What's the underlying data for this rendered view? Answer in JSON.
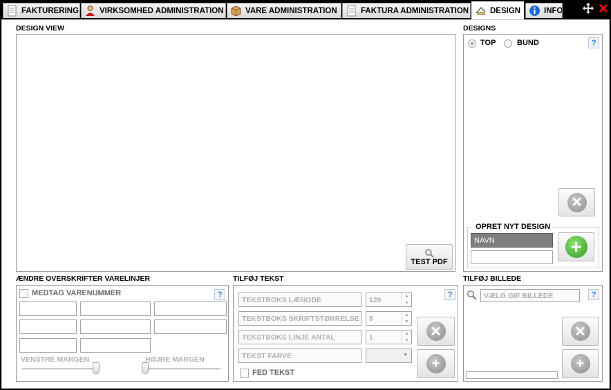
{
  "tabs": [
    {
      "label": "FAKTURERING",
      "icon": "document-icon"
    },
    {
      "label": "VIRKSOMHED ADMINISTRATION",
      "icon": "user-icon"
    },
    {
      "label": "VARE ADMINISTRATION",
      "icon": "box-icon"
    },
    {
      "label": "FAKTURA ADMINISTRATION",
      "icon": "document-icon"
    },
    {
      "label": "DESIGN",
      "icon": "design-icon",
      "active": true
    },
    {
      "label": "INFO",
      "icon": "info-icon"
    }
  ],
  "design_view": {
    "title": "DESIGN VIEW",
    "test_pdf_label": "TEST PDF"
  },
  "designs": {
    "title": "DESIGNS",
    "radio_top": "TOP",
    "radio_bund": "BUND",
    "help": "?",
    "new_design": {
      "title": "OPRET NYT DESIGN",
      "name_value": "NAVN",
      "second_value": ""
    }
  },
  "headers": {
    "title": "ÆNDRE OVERSKRIFTER VARELINJER",
    "include_number": "MEDTAG VARENUMMER",
    "help": "?",
    "left_margin": "VENSTRE MARGEN",
    "right_margin": "HØJRE MARGEN"
  },
  "text": {
    "title": "TILFØJ TEKST",
    "help": "?",
    "rows": [
      {
        "label": "TEKSTBOKS LÆNGDE",
        "value": "120"
      },
      {
        "label": "TEKSTBOKS SKRIFTSTØRRELSE",
        "value": "8"
      },
      {
        "label": "TEKSTBOKS LINJE ANTAL",
        "value": "1"
      },
      {
        "label": "TEKST FARVE",
        "value": ""
      }
    ],
    "bold_label": "FED TEKST"
  },
  "image": {
    "title": "TILFØJ BILLEDE",
    "placeholder": "VÆLG GIF BILLEDE",
    "help": "?"
  },
  "colors": {
    "accent_green": "#2e9b1d",
    "help_blue": "#3f8fe0",
    "close_red": "#e01010"
  }
}
